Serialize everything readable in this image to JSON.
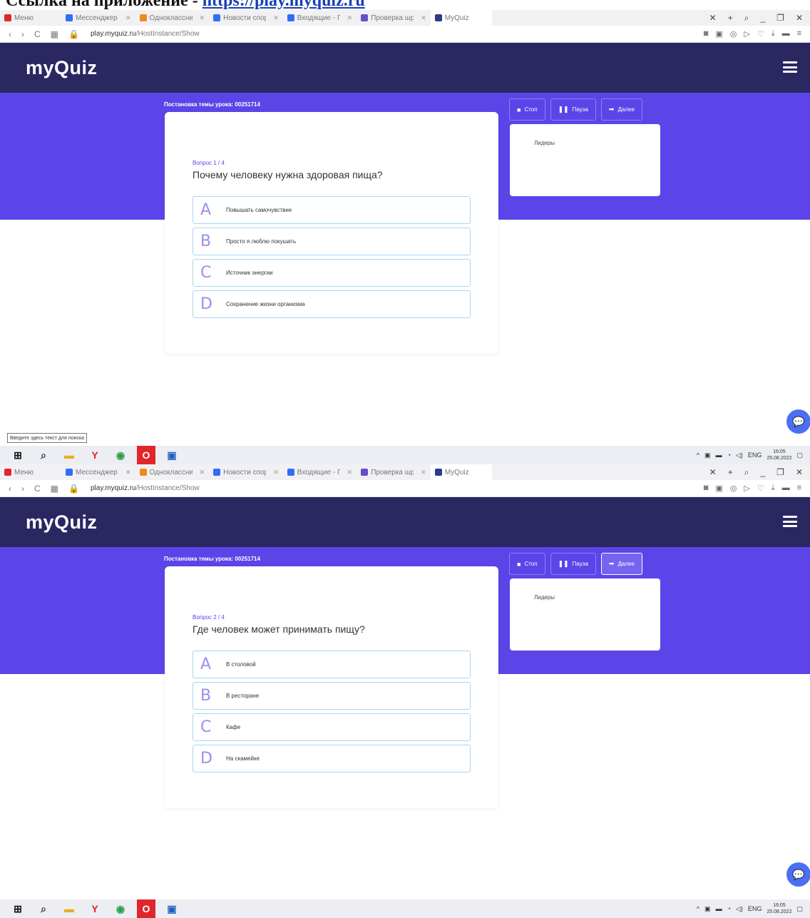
{
  "heading": {
    "text": "Ссылка на приложение -",
    "link": "https://play.myquiz.ru"
  },
  "browser": {
    "tabs": [
      {
        "label": "Меню",
        "icon_color": "#e0262a"
      },
      {
        "label": "Мессенджер",
        "icon_color": "#2f6ff5"
      },
      {
        "label": "Одноклассники",
        "icon_color": "#f08a1c"
      },
      {
        "label": "Новости спорта, Секс",
        "icon_color": "#2f6ff5"
      },
      {
        "label": "Входящие - Почта Mail.ru",
        "icon_color": "#2f6ff5"
      },
      {
        "label": "Проверка шрифтов Онлайн",
        "icon_color": "#6a4cc9"
      },
      {
        "label": "MyQuiz",
        "icon_color": "#2b3a8c",
        "active": true
      }
    ],
    "address_domain": "play.myquiz.ru",
    "address_path": "/HostInstance/Show",
    "window_controls": [
      "×",
      "+",
      "🔍",
      "_",
      "❐",
      "✕"
    ]
  },
  "app": {
    "logo": "myQuiz",
    "topic_label": "Постановка темы урока: 00251714",
    "controls": {
      "stop": "Стоп",
      "pause": "Пауза",
      "next": "Далее"
    },
    "leaders_title": "Лидеры"
  },
  "questions": [
    {
      "number": "Вопрос 1 / 4",
      "text": "Почему человеку нужна здоровая пища?",
      "answers": [
        {
          "letter": "A",
          "text": "Повышать самочувствие"
        },
        {
          "letter": "B",
          "text": "Просто я люблю покушать"
        },
        {
          "letter": "C",
          "text": "Источник энергии"
        },
        {
          "letter": "D",
          "text": "Сохранение жизни организма"
        }
      ]
    },
    {
      "number": "Вопрос 2 / 4",
      "text": "Где человек может принимать пищу?",
      "answers": [
        {
          "letter": "A",
          "text": "В столовой"
        },
        {
          "letter": "B",
          "text": "В ресторане"
        },
        {
          "letter": "C",
          "text": "Кафе"
        },
        {
          "letter": "D",
          "text": "На скамейке"
        }
      ]
    }
  ],
  "taskbar": {
    "search_tooltip": "Введите здесь текст для поиска",
    "language": "ENG",
    "time": "16:05",
    "date": "25.08.2022"
  },
  "colors": {
    "app_header": "#2a2761",
    "accent_band": "#5b45e8",
    "answer_border": "#a9d5f2",
    "letter": "#9a90ee"
  }
}
